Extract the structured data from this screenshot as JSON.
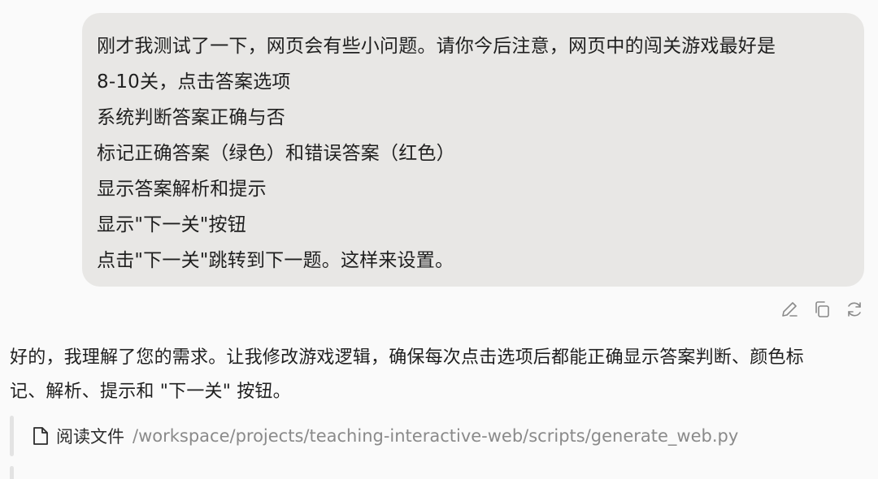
{
  "user_message": {
    "lines": [
      "刚才我测试了一下，网页会有些小问题。请你今后注意，网页中的闯关游戏最好是",
      "8-10关，点击答案选项",
      "系统判断答案正确与否",
      "标记正确答案（绿色）和错误答案（红色）",
      "显示答案解析和提示",
      "显示\"下一关\"按钮",
      "点击\"下一关\"跳转到下一题。这样来设置。"
    ]
  },
  "message_actions": {
    "icons": [
      "edit-icon",
      "copy-icon",
      "regenerate-icon"
    ],
    "color": "#8a8a8a"
  },
  "assistant_message": {
    "lines": [
      "好的，我理解了您的需求。让我修改游戏逻辑，确保每次点击选项后都能正确显示答案判断、颜色标",
      "记、解析、提示和 \"下一关\" 按钮。"
    ]
  },
  "tool_call": {
    "icon": "file-icon",
    "label": "阅读文件",
    "path": "/workspace/projects/teaching-interactive-web/scripts/generate_web.py"
  }
}
